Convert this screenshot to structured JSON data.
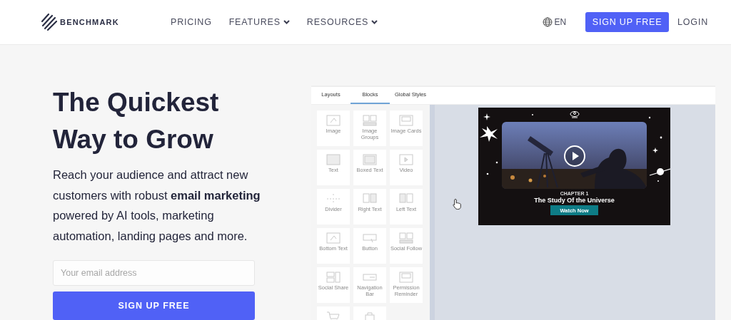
{
  "header": {
    "logo": "BENCHMARK",
    "nav": [
      {
        "label": "PRICING",
        "dropdown": false
      },
      {
        "label": "FEATURES",
        "dropdown": true
      },
      {
        "label": "RESOURCES",
        "dropdown": true
      }
    ],
    "language": "EN",
    "signup": "SIGN UP FREE",
    "login": "LOGIN"
  },
  "hero": {
    "headline": [
      "The Quickest",
      "Way to Grow"
    ],
    "text": "Reach your audience and attract new customers with robust **email marketing** powered by AI tools, marketing automation, landing pages and more.",
    "email": {
      "placeholder": "Your email address"
    },
    "signup": "SIGN UP FREE"
  },
  "editor": {
    "tabs": [
      {
        "label": "Layouts",
        "selected": false
      },
      {
        "label": "Blocks",
        "selected": true
      },
      {
        "label": "Global Styles",
        "selected": false
      }
    ],
    "blocks": [
      {
        "label": "Image"
      },
      {
        "label": "Image Groups",
        "kind": "images"
      },
      {
        "label": "Image Cards",
        "kind": "card"
      },
      {
        "label": "Text",
        "kind": "text"
      },
      {
        "label": "Boxed Text",
        "kind": "boxed"
      },
      {
        "label": "Video",
        "kind": "video"
      },
      {
        "label": "Divider",
        "kind": "divider"
      },
      {
        "label": "Right Text",
        "kind": "right"
      },
      {
        "label": "Left Text",
        "kind": "left"
      },
      {
        "label": "Bottom Text"
      },
      {
        "label": "Button",
        "kind": "button"
      },
      {
        "label": "Social Follow",
        "kind": "images"
      },
      {
        "label": "Social Share",
        "kind": "share"
      },
      {
        "label": "Navigation Bar",
        "kind": "nav"
      },
      {
        "label": "Permission Reminder",
        "kind": "card"
      },
      {
        "kind": "cart"
      },
      {
        "kind": "bag"
      }
    ],
    "email": {
      "chapter": "CHAPTER 1",
      "title": "The Study Of the Universe",
      "button": "Watch Now"
    }
  }
}
